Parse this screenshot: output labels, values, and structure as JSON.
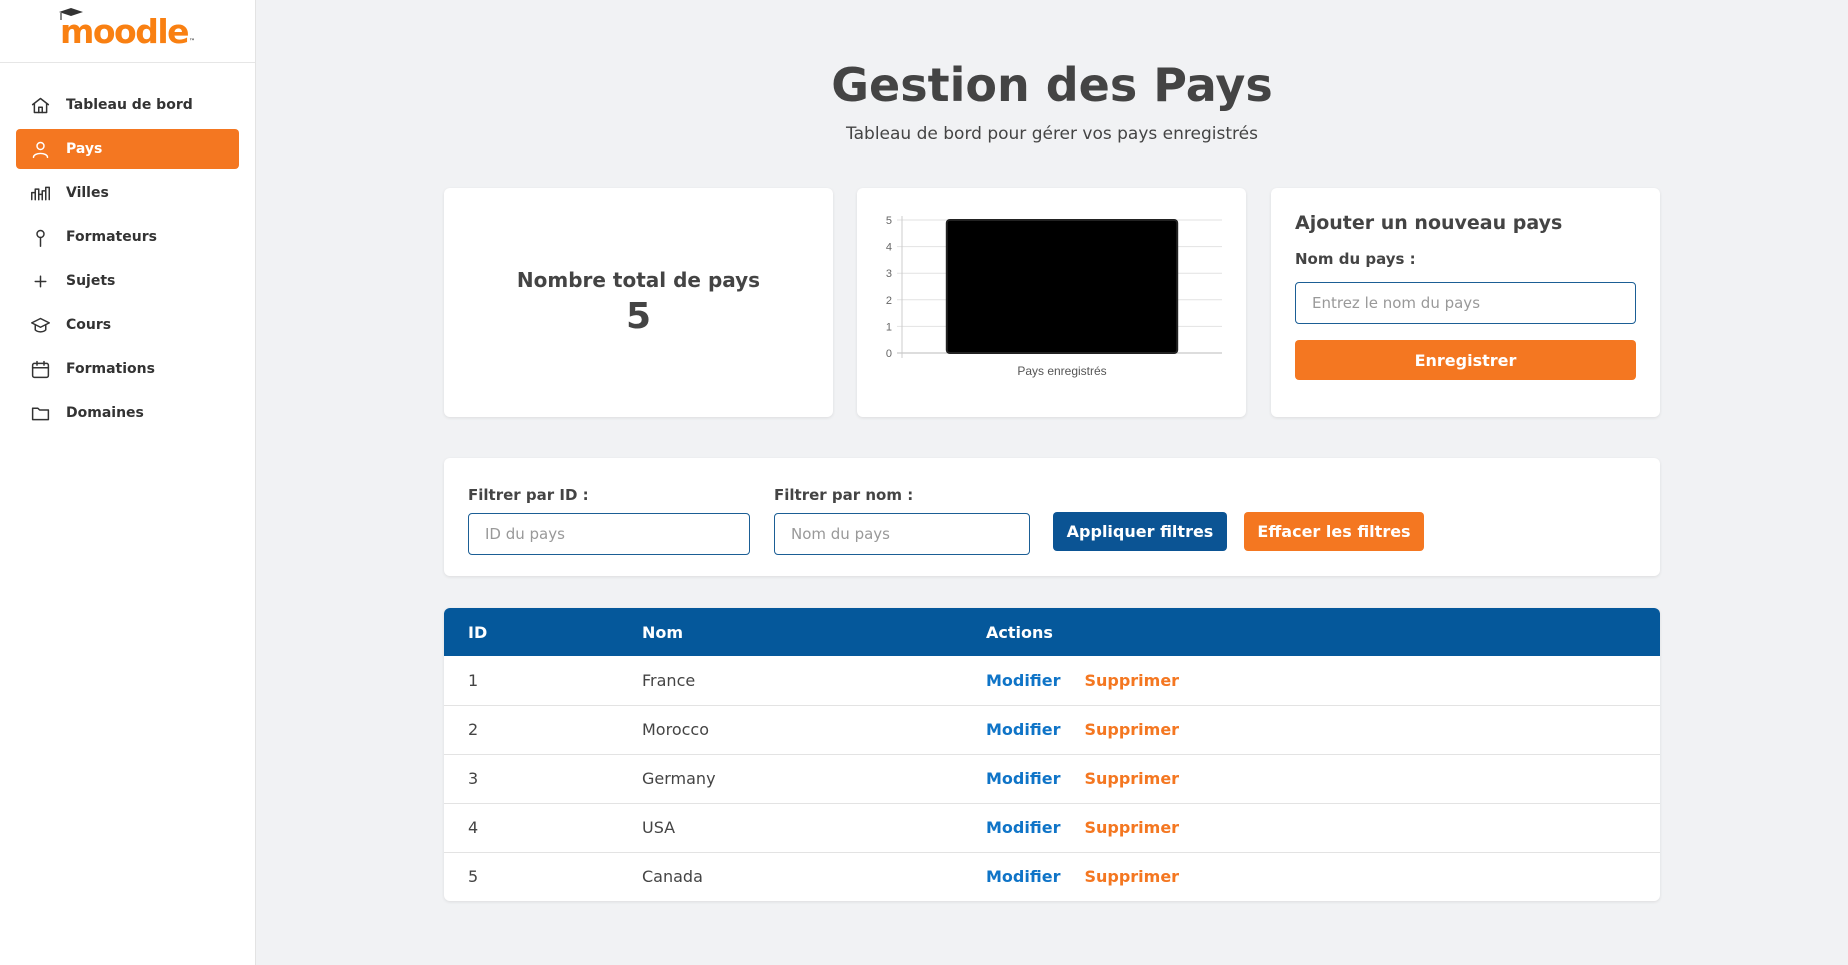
{
  "brand": {
    "logo_text": "moodle",
    "logo_tm": "™",
    "accent": "#f47721",
    "primary": "#05589b"
  },
  "sidebar": {
    "items": [
      {
        "label": "Tableau de bord",
        "icon": "home-icon",
        "active": false
      },
      {
        "label": "Pays",
        "icon": "user-icon",
        "active": true
      },
      {
        "label": "Villes",
        "icon": "city-icon",
        "active": false
      },
      {
        "label": "Formateurs",
        "icon": "pin-icon",
        "active": false
      },
      {
        "label": "Sujets",
        "icon": "plus-icon",
        "active": false
      },
      {
        "label": "Cours",
        "icon": "graduation-cap-icon",
        "active": false
      },
      {
        "label": "Formations",
        "icon": "calendar-icon",
        "active": false
      },
      {
        "label": "Domaines",
        "icon": "folder-icon",
        "active": false
      }
    ]
  },
  "header": {
    "title": "Gestion des Pays",
    "subtitle": "Tableau de bord pour gérer vos pays enregistrés"
  },
  "stats": {
    "label": "Nombre total de pays",
    "value": "5"
  },
  "chart_data": {
    "type": "bar",
    "categories": [
      "Pays enregistrés"
    ],
    "values": [
      5
    ],
    "ylim": [
      0,
      5
    ],
    "yticks": [
      "0",
      "1",
      "2",
      "3",
      "4",
      "5"
    ],
    "grid": true,
    "bar_color": "#000000"
  },
  "add_form": {
    "title": "Ajouter un nouveau pays",
    "label": "Nom du pays :",
    "placeholder": "Entrez le nom du pays",
    "value": "",
    "button": "Enregistrer"
  },
  "filters": {
    "id_label": "Filtrer par ID :",
    "id_placeholder": "ID du pays",
    "name_label": "Filtrer par nom :",
    "name_placeholder": "Nom du pays",
    "apply": "Appliquer filtres",
    "clear": "Effacer les filtres"
  },
  "table": {
    "headers": {
      "id": "ID",
      "name": "Nom",
      "actions": "Actions"
    },
    "edit_label": "Modifier",
    "delete_label": "Supprimer",
    "rows": [
      {
        "id": "1",
        "name": "France"
      },
      {
        "id": "2",
        "name": "Morocco"
      },
      {
        "id": "3",
        "name": "Germany"
      },
      {
        "id": "4",
        "name": "USA"
      },
      {
        "id": "5",
        "name": "Canada"
      }
    ]
  }
}
